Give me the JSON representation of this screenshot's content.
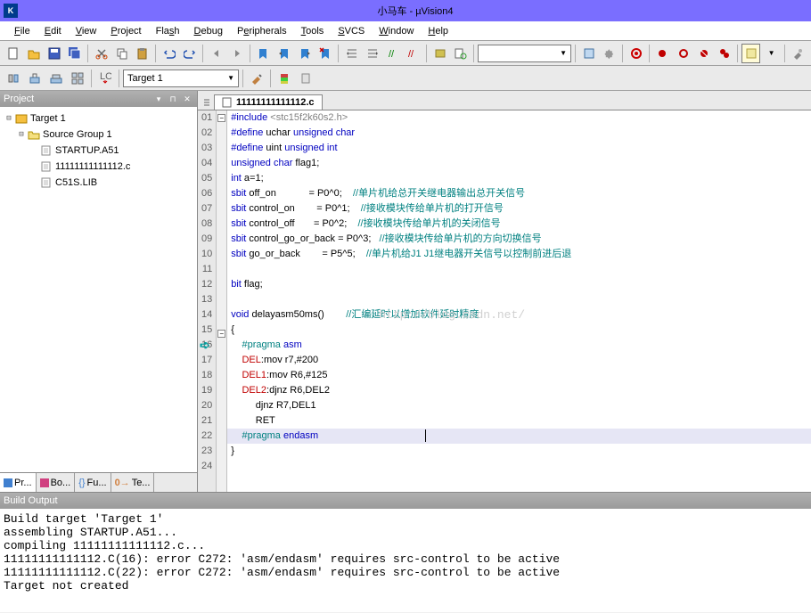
{
  "titlebar": {
    "title": "小马车  - µVision4"
  },
  "menubar": [
    {
      "label": "File",
      "u": "F"
    },
    {
      "label": "Edit",
      "u": "E"
    },
    {
      "label": "View",
      "u": "V"
    },
    {
      "label": "Project",
      "u": "P"
    },
    {
      "label": "Flash",
      "u": "s"
    },
    {
      "label": "Debug",
      "u": "D"
    },
    {
      "label": "Peripherals",
      "u": "e"
    },
    {
      "label": "Tools",
      "u": "T"
    },
    {
      "label": "SVCS",
      "u": "S"
    },
    {
      "label": "Window",
      "u": "W"
    },
    {
      "label": "Help",
      "u": "H"
    }
  ],
  "target_combo": "Target 1",
  "project_panel": {
    "title": "Project",
    "tree": {
      "root": "Target 1",
      "group": "Source Group 1",
      "files": [
        "STARTUP.A51",
        "11111111111112.c",
        "C51S.LIB"
      ]
    },
    "bottom_tabs": [
      "Pr...",
      "Bo...",
      "Fu...",
      "Te..."
    ]
  },
  "editor": {
    "tab_filename": "11111111111112.c",
    "lines": [
      {
        "n": 1,
        "fold": "-",
        "html": "<span class='kw-pre'>#include</span> <span class='str'>&lt;stc15f2k60s2.h&gt;</span>"
      },
      {
        "n": 2,
        "html": "<span class='kw-pre'>#define</span> uchar <span class='kw-pre'>unsigned char</span>"
      },
      {
        "n": 3,
        "html": "<span class='kw-pre'>#define</span> uint <span class='kw-pre'>unsigned int</span>"
      },
      {
        "n": 4,
        "html": "<span class='kw-pre'>unsigned char</span> flag1;"
      },
      {
        "n": 5,
        "html": "<span class='kw-pre'>int</span> a=1;"
      },
      {
        "n": 6,
        "html": "<span class='kw-pre'>sbit</span> off_on            = P0^0;    <span class='comment'>//单片机给总开关继电器输出总开关信号</span>"
      },
      {
        "n": 7,
        "html": "<span class='kw-pre'>sbit</span> control_on        = P0^1;    <span class='comment'>//接收模块传给单片机的打开信号</span>"
      },
      {
        "n": 8,
        "html": "<span class='kw-pre'>sbit</span> control_off       = P0^2;    <span class='comment'>//接收模块传给单片机的关闭信号</span>"
      },
      {
        "n": 9,
        "html": "<span class='kw-pre'>sbit</span> control_go_or_back = P0^3;   <span class='comment'>//接收模块传给单片机的方向切换信号</span>"
      },
      {
        "n": 10,
        "html": "<span class='kw-pre'>sbit</span> go_or_back        = P5^5;    <span class='comment'>//单片机给J1 J1继电器开关信号以控制前进后退</span>"
      },
      {
        "n": 11,
        "html": ""
      },
      {
        "n": 12,
        "html": "<span class='kw-pre'>bit</span> flag;"
      },
      {
        "n": 13,
        "html": ""
      },
      {
        "n": 14,
        "html": "<span class='kw-pre'>void</span> delayasm50ms()        <span class='comment'>//汇编延时以增加软件延时精度</span>"
      },
      {
        "n": 15,
        "fold": "-",
        "html": "{"
      },
      {
        "n": 16,
        "arrow": true,
        "html": "    <span class='kw-green'>#pragma</span> <span class='kw-pre'>asm</span>"
      },
      {
        "n": 17,
        "html": "    <span class='kw-red'>DEL</span>:mov r7,#200"
      },
      {
        "n": 18,
        "html": "    <span class='kw-red'>DEL1</span>:mov R6,#125"
      },
      {
        "n": 19,
        "html": "    <span class='kw-red'>DEL2</span>:djnz R6,DEL2"
      },
      {
        "n": 20,
        "html": "         djnz R7,DEL1"
      },
      {
        "n": 21,
        "html": "         RET"
      },
      {
        "n": 22,
        "hl": true,
        "html": "    <span class='kw-green'>#pragma</span> <span class='kw-pre'>endasm</span>"
      },
      {
        "n": 23,
        "html": "}"
      },
      {
        "n": 24,
        "html": ""
      }
    ],
    "watermark": "http://blog.csdn.net/"
  },
  "build": {
    "title": "Build Output",
    "content": "Build target 'Target 1'\nassembling STARTUP.A51...\ncompiling 11111111111112.c...\n11111111111112.C(16): error C272: 'asm/endasm' requires src-control to be active\n11111111111112.C(22): error C272: 'asm/endasm' requires src-control to be active\nTarget not created"
  }
}
